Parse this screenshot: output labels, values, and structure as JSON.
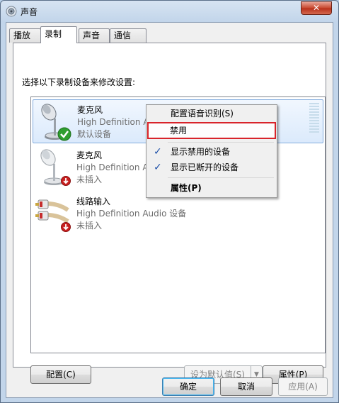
{
  "window": {
    "title": "声音",
    "close_label": "✕"
  },
  "tabs": [
    {
      "label": "播放"
    },
    {
      "label": "录制"
    },
    {
      "label": "声音"
    },
    {
      "label": "通信"
    }
  ],
  "instruction": "选择以下录制设备来修改设置:",
  "devices": [
    {
      "name": "麦克风",
      "description": "High Definition Audio 设备",
      "status": "默认设备",
      "icon": "microphone-icon",
      "badge": "green-check-badge"
    },
    {
      "name": "麦克风",
      "description": "High Definition Audio 设备",
      "status": "未插入",
      "icon": "microphone-icon",
      "badge": "red-down-arrow-badge"
    },
    {
      "name": "线路输入",
      "description": "High Definition Audio 设备",
      "status": "未插入",
      "icon": "line-in-rca-icon",
      "badge": "red-down-arrow-badge"
    }
  ],
  "context_menu": {
    "items": [
      {
        "label": "配置语音识别(S)",
        "checked": false
      },
      {
        "label": "禁用",
        "checked": false
      },
      {
        "label": "显示禁用的设备",
        "checked": true
      },
      {
        "label": "显示已断开的设备",
        "checked": true
      },
      {
        "label": "属性(P)",
        "checked": false
      }
    ],
    "check_glyph": "✓"
  },
  "buttons": {
    "configure": "配置(C)",
    "set_default": "设为默认值(S)",
    "properties": "属性(P)",
    "ok": "确定",
    "cancel": "取消",
    "apply": "应用(A)"
  },
  "colors": {
    "highlight_border": "#d8232a",
    "selection": "#dbeafc",
    "check": "#1c4fa8"
  }
}
